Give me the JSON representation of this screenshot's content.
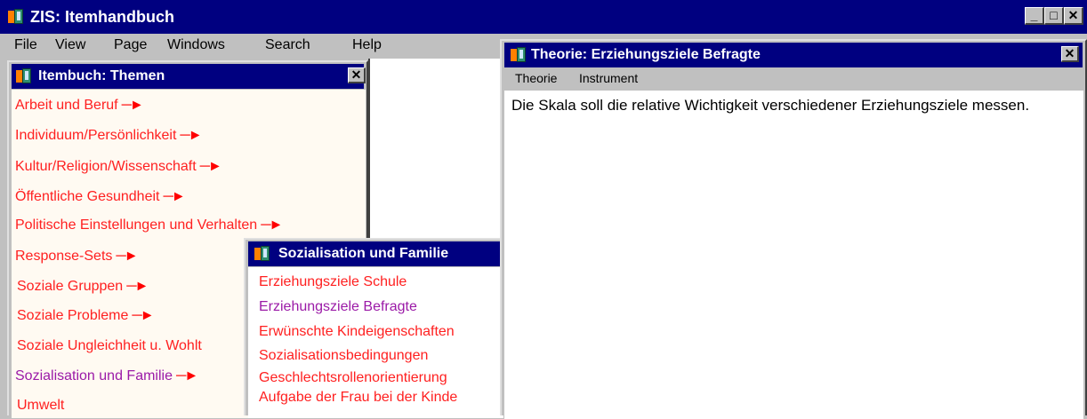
{
  "app": {
    "title": "ZIS: Itemhandbuch",
    "window_buttons": {
      "minimize": "_",
      "maximize": "□",
      "close": "✕"
    }
  },
  "menubar": {
    "items": [
      {
        "label": "File"
      },
      {
        "label": "View"
      },
      {
        "label": "Page"
      },
      {
        "label": "Windows"
      },
      {
        "label": "Search"
      },
      {
        "label": "Help"
      }
    ]
  },
  "themen_window": {
    "title": "Itembuch: Themen",
    "topics": [
      {
        "label": "Arbeit und Beruf",
        "arrow": true,
        "visited": false
      },
      {
        "label": "Individuum/Persönlichkeit",
        "arrow": true,
        "visited": false
      },
      {
        "label": "Kultur/Religion/Wissenschaft",
        "arrow": true,
        "visited": false
      },
      {
        "label": "Öffentliche Gesundheit",
        "arrow": true,
        "visited": false
      },
      {
        "label": "Politische Einstellungen und Verhalten",
        "arrow": true,
        "visited": false
      },
      {
        "label": "Response-Sets",
        "arrow": true,
        "visited": false
      },
      {
        "label": "Soziale Gruppen",
        "arrow": true,
        "visited": false
      },
      {
        "label": "Soziale Probleme",
        "arrow": true,
        "visited": false
      },
      {
        "label": "Soziale Ungleichheit u. Wohlt",
        "arrow": false,
        "visited": false
      },
      {
        "label": "Sozialisation und Familie",
        "arrow": true,
        "visited": true
      },
      {
        "label": "Umwelt",
        "arrow": false,
        "visited": false
      }
    ]
  },
  "sozial_window": {
    "title": "Sozialisation und Familie",
    "items": [
      {
        "label": "Erziehungsziele Schule",
        "visited": false
      },
      {
        "label": "Erziehungsziele Befragte",
        "visited": true
      },
      {
        "label": "Erwünschte Kindeigenschaften",
        "visited": false
      },
      {
        "label": "Sozialisationsbedingungen",
        "visited": false
      },
      {
        "label": "Geschlechtsrollenorientierung",
        "visited": false
      },
      {
        "label": "Aufgabe der Frau bei der Kinde",
        "visited": false
      }
    ]
  },
  "theorie_window": {
    "title": "Theorie: Erziehungsziele Befragte",
    "menu": [
      {
        "label": "Theorie"
      },
      {
        "label": "Instrument"
      }
    ],
    "text": "Die Skala soll die relative Wichtigkeit verschiedener Erziehungsziele messen."
  },
  "colors": {
    "titlebar": "#000080",
    "link": "#ff2020",
    "visited_link": "#9b1aa7",
    "arrow": "#ff0000"
  },
  "icons": {
    "app": "zis-app-icon",
    "arrow": "red-arrow-icon"
  }
}
